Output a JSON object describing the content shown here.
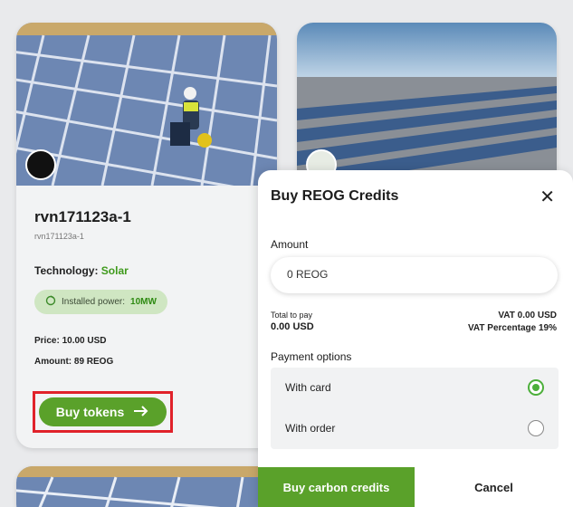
{
  "projects": [
    {
      "title": "rvn171123a-1",
      "subtitle": "rvn171123a-1",
      "technology_label": "Technology:",
      "technology_value": "Solar",
      "power_label": "Installed power:",
      "power_value": "10MW",
      "price_label": "Price:",
      "price_value": "10.00 USD",
      "amount_label": "Amount:",
      "amount_value": "89 REOG",
      "buy_label": "Buy tokens",
      "buy_icon": "arrow-right-icon"
    }
  ],
  "modal": {
    "title": "Buy REOG Credits",
    "close_icon": "close-icon",
    "amount_label": "Amount",
    "amount_value": "0 REOG",
    "total_label": "Total to pay",
    "total_value": "0.00 USD",
    "vat_value": "VAT 0.00 USD",
    "vat_percentage": "VAT Percentage 19%",
    "payment_label": "Payment options",
    "payment_options": [
      {
        "label": "With card",
        "selected": true
      },
      {
        "label": "With order",
        "selected": false
      }
    ],
    "buy_button": "Buy carbon credits",
    "cancel_button": "Cancel"
  },
  "colors": {
    "accent_green": "#5aa12a",
    "highlight_red": "#e0222a",
    "solar_text": "#3f9a1c"
  }
}
